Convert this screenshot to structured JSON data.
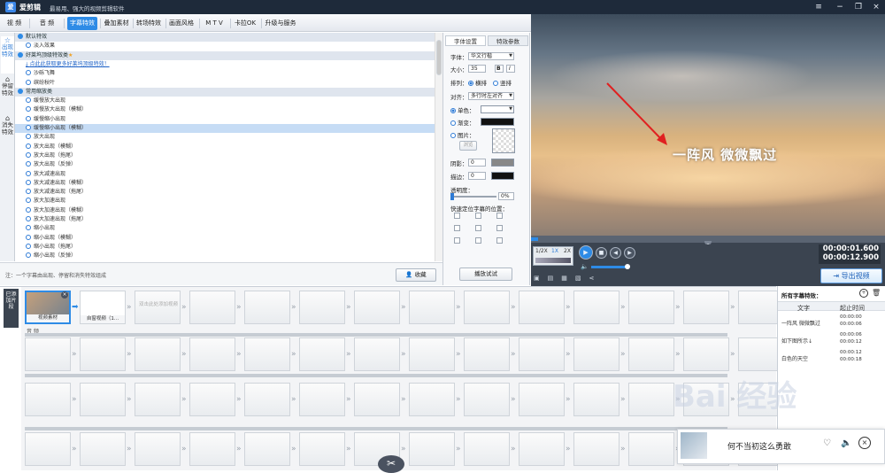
{
  "app": {
    "name": "爱剪辑",
    "slogan": "最易用、强大的视频剪辑软件",
    "logo_text": "爱"
  },
  "window_buttons": [
    "≡",
    "−",
    "❐",
    "×"
  ],
  "tabs": [
    "视 频",
    "音 频",
    "字幕特效",
    "叠加素材",
    "转场特效",
    "画面风格",
    "M T V",
    "卡拉OK",
    "升级与服务"
  ],
  "active_tab": "字幕特效",
  "side_tabs": [
    {
      "icon": "star-icon",
      "label": "出现特效"
    },
    {
      "icon": "home-icon",
      "label": "停留特效"
    },
    {
      "icon": "home-icon",
      "label": "消失特效"
    }
  ],
  "effect_list": [
    {
      "type": "group",
      "label": "默认特效"
    },
    {
      "type": "item",
      "label": "淡入效果"
    },
    {
      "type": "group",
      "label": "好莱坞顶级特效类",
      "star": "★"
    },
    {
      "type": "link",
      "label": "点此此获取更多好莱坞顶级特效！"
    },
    {
      "type": "item",
      "label": "沙砾飞舞"
    },
    {
      "type": "item",
      "label": "缤纷秋叶"
    },
    {
      "type": "group",
      "label": "常用缩放类"
    },
    {
      "type": "item",
      "label": "缓慢放大出现"
    },
    {
      "type": "item",
      "label": "缓慢放大出现（模糊）"
    },
    {
      "type": "item",
      "label": "缓慢缩小出现"
    },
    {
      "type": "item",
      "label": "缓慢缩小出现（模糊）",
      "selected": true
    },
    {
      "type": "item",
      "label": "放大出现"
    },
    {
      "type": "item",
      "label": "放大出现（模糊）"
    },
    {
      "type": "item",
      "label": "放大出现（拖尾）"
    },
    {
      "type": "item",
      "label": "放大出现（反弹）"
    },
    {
      "type": "item",
      "label": "放大减速出现"
    },
    {
      "type": "item",
      "label": "放大减速出现（模糊）"
    },
    {
      "type": "item",
      "label": "放大减速出现（拖尾）"
    },
    {
      "type": "item",
      "label": "放大加速出现"
    },
    {
      "type": "item",
      "label": "放大加速出现（模糊）"
    },
    {
      "type": "item",
      "label": "放大加速出现（拖尾）"
    },
    {
      "type": "item",
      "label": "缩小出现"
    },
    {
      "type": "item",
      "label": "缩小出现（模糊）"
    },
    {
      "type": "item",
      "label": "缩小出现（拖尾）"
    },
    {
      "type": "item",
      "label": "缩小出现（反弹）"
    }
  ],
  "left_bottom": {
    "note": "注：一个字幕由出现、停留和消失特效组成",
    "collect_label": "收藏",
    "preview_label": "播放试试"
  },
  "settings": {
    "tabs": [
      "字体设置",
      "特效参数"
    ],
    "font_label": "字体：",
    "font_value": "华文行楷",
    "size_label": "大小：",
    "size_value": "35",
    "bold": "B",
    "italic": "I",
    "arrange_label": "排列：",
    "arrange_h": "横排",
    "arrange_v": "竖排",
    "align_label": "对齐：",
    "align_value": "多行时左对齐",
    "single_color": "单色：",
    "gradient": "渐变：",
    "image": "图片：",
    "browse": "浏览",
    "shadow_label": "阴影：",
    "shadow_value": "0",
    "stroke_label": "描边：",
    "stroke_value": "0",
    "opacity_label": "透明度：",
    "opacity_value": "0%",
    "position_label": "快速定位字幕的位置："
  },
  "preview": {
    "caption": "一阵风  微微飘过",
    "time_current": "00:00:01.600",
    "time_total": "00:00:12.900",
    "speeds": [
      "1/2X",
      "1X",
      "2X"
    ],
    "export_label": "导出视频"
  },
  "timeline": {
    "added_label": "已添加片段",
    "clips": [
      {
        "label": "视频素材"
      },
      {
        "label": "自窗视频（1..."
      }
    ],
    "add_hint": "双击此处添加视频",
    "audio_label": "音 频"
  },
  "subtitle_panel": {
    "title": "所有字幕特效：",
    "col_text": "文字",
    "col_time": "起止时间",
    "rows": [
      {
        "text": "一阵风  微微飘过",
        "start": "00:00:00",
        "end": "00:00:06"
      },
      {
        "text": "如下图所示↓",
        "start": "00:00:06",
        "end": "00:00:12"
      },
      {
        "text": "白色的天空",
        "start": "00:00:12",
        "end": "00:00:18"
      }
    ]
  },
  "notify": {
    "text": "何不当初这么勇敢"
  },
  "watermark": "Bai 经验"
}
